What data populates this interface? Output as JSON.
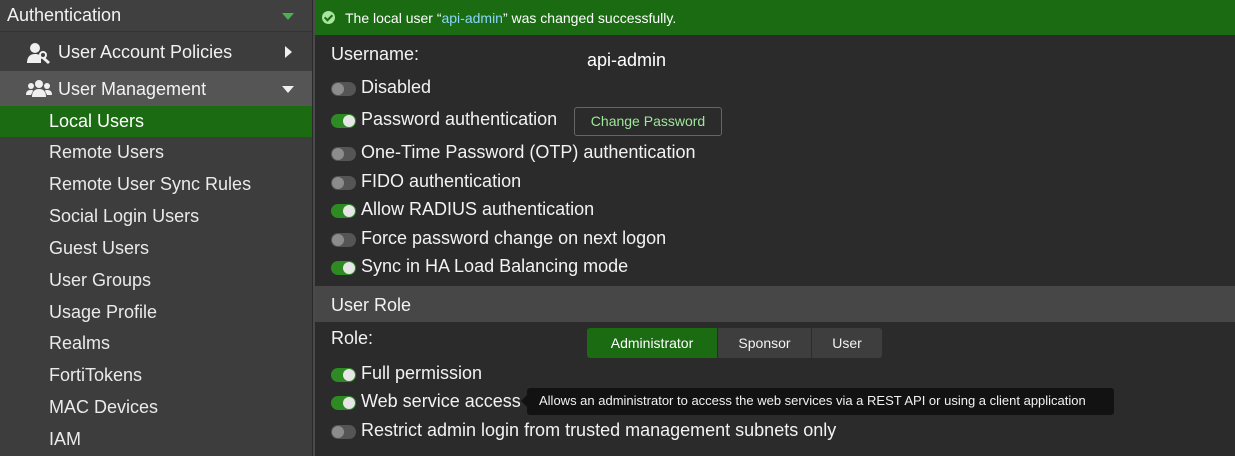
{
  "sidebar": {
    "top_label": "Authentication",
    "sections": [
      {
        "label": "User Account Policies"
      },
      {
        "label": "User Management"
      }
    ],
    "items": [
      {
        "label": "Local Users"
      },
      {
        "label": "Remote Users"
      },
      {
        "label": "Remote User Sync Rules"
      },
      {
        "label": "Social Login Users"
      },
      {
        "label": "Guest Users"
      },
      {
        "label": "User Groups"
      },
      {
        "label": "Usage Profile"
      },
      {
        "label": "Realms"
      },
      {
        "label": "FortiTokens"
      },
      {
        "label": "MAC Devices"
      },
      {
        "label": "IAM"
      }
    ]
  },
  "banner": {
    "prefix": "The local user “",
    "user": "api-admin",
    "suffix": "” was changed successfully."
  },
  "form": {
    "username_label": "Username:",
    "username_value": "api-admin",
    "change_password_label": "Change Password",
    "toggles": [
      {
        "label": "Disabled",
        "state": "off"
      },
      {
        "label": "Password authentication",
        "state": "on"
      },
      {
        "label": "One-Time Password (OTP) authentication",
        "state": "off"
      },
      {
        "label": "FIDO authentication",
        "state": "off"
      },
      {
        "label": "Allow RADIUS authentication",
        "state": "on"
      },
      {
        "label": "Force password change on next logon",
        "state": "off"
      },
      {
        "label": "Sync in HA Load Balancing mode",
        "state": "on"
      }
    ]
  },
  "user_role": {
    "header": "User Role",
    "role_label": "Role:",
    "options": [
      "Administrator",
      "Sponsor",
      "User"
    ],
    "selected": "Administrator",
    "toggles": [
      {
        "label": "Full permission",
        "state": "on"
      },
      {
        "label": "Web service access",
        "state": "on"
      },
      {
        "label": "Restrict admin login from trusted management subnets only",
        "state": "off"
      }
    ],
    "tooltip": "Allows an administrator to access the web services via a REST API or using a client application"
  },
  "colors": {
    "accent_green": "#1b6b12",
    "active_item": "#1a6b12",
    "link_blue": "#8ad5ff"
  }
}
